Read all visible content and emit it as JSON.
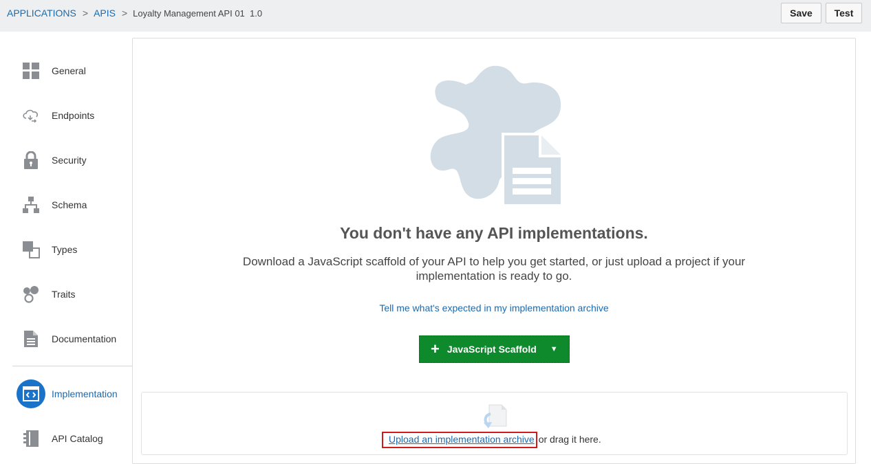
{
  "breadcrumb": {
    "applications": "APPLICATIONS",
    "sep1": ">",
    "apis": "APIS",
    "sep2": ">",
    "current": "Loyalty Management API 01  1.0"
  },
  "toolbar": {
    "save_label": "Save",
    "test_label": "Test"
  },
  "sidebar": {
    "items": [
      {
        "label": "General",
        "icon": "grid-icon"
      },
      {
        "label": "Endpoints",
        "icon": "cloud-sync-icon"
      },
      {
        "label": "Security",
        "icon": "lock-icon"
      },
      {
        "label": "Schema",
        "icon": "hierarchy-icon"
      },
      {
        "label": "Types",
        "icon": "types-icon"
      },
      {
        "label": "Traits",
        "icon": "traits-icon"
      },
      {
        "label": "Documentation",
        "icon": "document-icon"
      },
      {
        "label": "Implementation",
        "icon": "code-icon",
        "active": true
      },
      {
        "label": "API Catalog",
        "icon": "catalog-icon"
      }
    ]
  },
  "main": {
    "headline": "You don't have any API implementations.",
    "subtext": "Download a JavaScript scaffold of your API to help you get started, or just upload a project if your implementation is ready to go.",
    "help_link": "Tell me what's expected in my implementation archive",
    "scaffold_button": "JavaScript Scaffold",
    "upload_link": "Upload an implementation archive",
    "upload_rest": "or drag it here."
  },
  "colors": {
    "accent": "#1a73c9",
    "link": "#1a6ab0",
    "scaffold_green": "#0e8a2c",
    "puzzle": "#d3dde6",
    "highlight_border": "#d11b1b"
  }
}
